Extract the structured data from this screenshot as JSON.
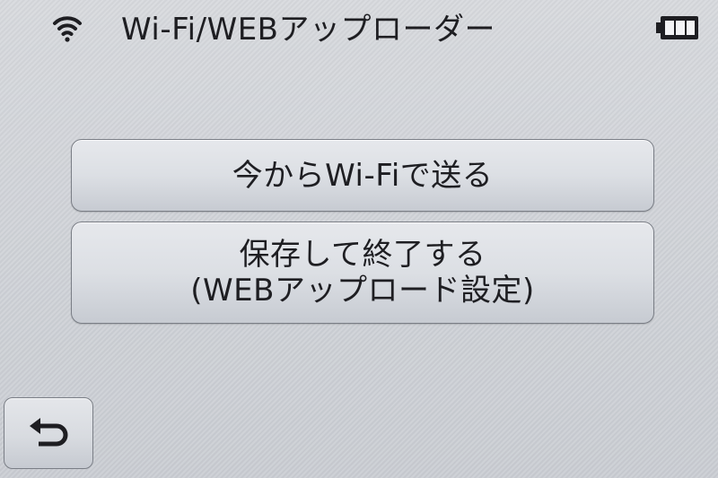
{
  "status_bar": {
    "title": "Wi-Fi/WEBアップローダー",
    "wifi_icon": "wifi-icon",
    "battery_icon": "battery-icon"
  },
  "menu": {
    "send_now": {
      "label": "今からWi-Fiで送る"
    },
    "save_and_exit": {
      "line1": "保存して終了する",
      "line2": "(WEBアップロード設定)"
    }
  },
  "footer": {
    "back_icon": "return-arrow-icon"
  },
  "colors": {
    "text": "#1e1e22",
    "button_border": "#7a7e86",
    "background": "#cfd2d7"
  }
}
